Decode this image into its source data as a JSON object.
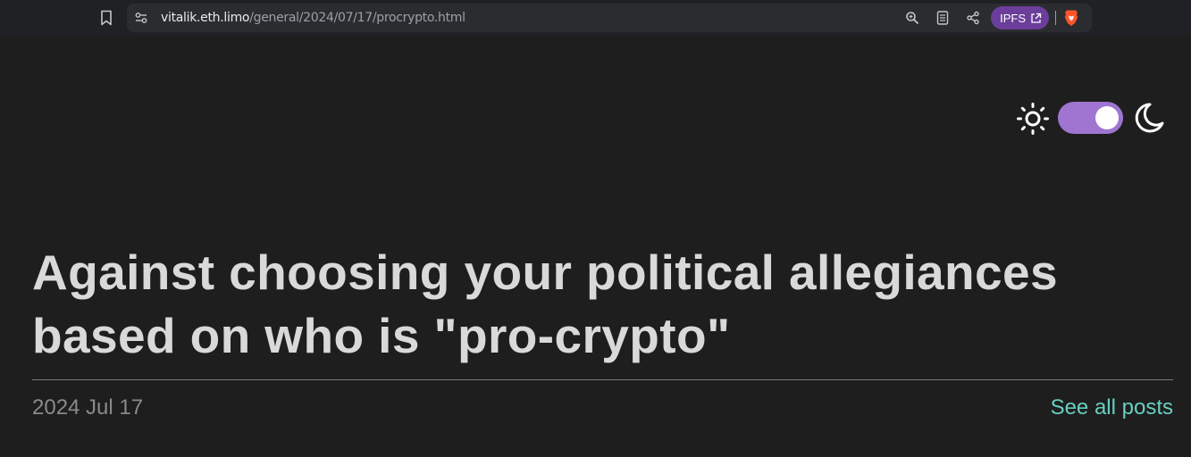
{
  "browser": {
    "url_host": "vitalik.eth.limo",
    "url_path": "/general/2024/07/17/procrypto.html",
    "ipfs_label": "IPFS",
    "icons": {
      "bookmark": "bookmark-icon",
      "site_settings": "site-settings-icon",
      "zoom": "zoom-icon",
      "reader": "reader-mode-icon",
      "share": "share-icon",
      "external": "external-link-icon",
      "brave": "brave-shields-icon"
    }
  },
  "theme_toggle": {
    "light_icon": "sun-icon",
    "dark_icon": "moon-icon",
    "state": "dark",
    "accent_color": "#9f75d1"
  },
  "post": {
    "title": "Against choosing your political allegiances based on who is \"pro-crypto\"",
    "date": "2024 Jul 17",
    "all_posts_label": "See all posts",
    "link_color": "#67cfc0"
  }
}
